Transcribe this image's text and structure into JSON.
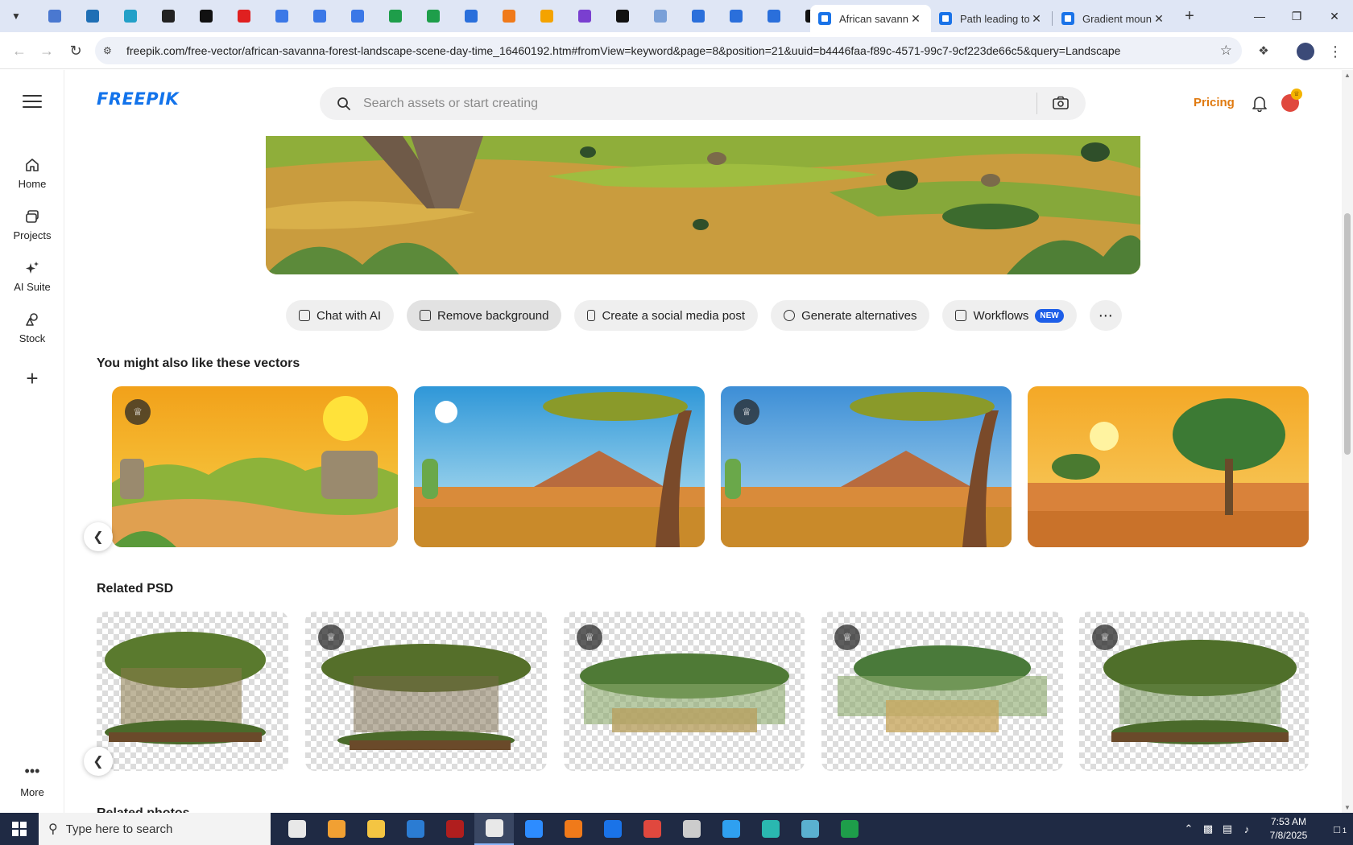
{
  "browser": {
    "tabs": [
      {
        "title": "African savanna",
        "active": true
      },
      {
        "title": "Path leading to",
        "active": false
      },
      {
        "title": "Gradient moun",
        "active": false
      }
    ],
    "url": "freepik.com/free-vector/african-savanna-forest-landscape-scene-day-time_16460192.htm#fromView=keyword&page=8&position=21&uuid=b4446faa-f89c-4571-99c7-9cf223de66c5&query=Landscape",
    "pinned_favicon_colors": [
      "#4a78d0",
      "#1f6fb5",
      "#23a0c8",
      "#222222",
      "#111111",
      "#e02020",
      "#3b78e7",
      "#3b78e7",
      "#3b78e7",
      "#1e9e4a",
      "#1e9e4a",
      "#2a6fdb",
      "#f07a1a",
      "#f4a300",
      "#7a3fd0",
      "#111111",
      "#7aa0d8",
      "#2a6fdb",
      "#2a6fdb",
      "#2a6fdb",
      "#111111"
    ]
  },
  "sidebar": {
    "items": [
      {
        "label": "Home",
        "icon": "home-icon"
      },
      {
        "label": "Projects",
        "icon": "projects-icon"
      },
      {
        "label": "AI Suite",
        "icon": "sparkle-icon"
      },
      {
        "label": "Stock",
        "icon": "stock-icon"
      }
    ],
    "more_label": "More"
  },
  "header": {
    "logo": "FREEPIK",
    "search_placeholder": "Search assets or start creating",
    "pricing_label": "Pricing"
  },
  "tools": [
    {
      "label": "Chat with AI",
      "icon": "chat-icon"
    },
    {
      "label": "Remove background",
      "icon": "remove-bg-icon"
    },
    {
      "label": "Create a social media post",
      "icon": "phone-icon"
    },
    {
      "label": "Generate alternatives",
      "icon": "refresh-icon"
    },
    {
      "label": "Workflows",
      "icon": "workflow-icon",
      "badge": "NEW"
    }
  ],
  "sections": {
    "vectors_title": "You might also like these vectors",
    "psd_title": "Related PSD",
    "photos_title": "Related photos"
  },
  "vectors": [
    {
      "scene": "sunset-savanna",
      "premium": true
    },
    {
      "scene": "acacia-desert",
      "premium": false
    },
    {
      "scene": "acacia-desert-blue",
      "premium": true
    },
    {
      "scene": "sunset-trees",
      "premium": false
    }
  ],
  "psd": [
    {
      "scene": "tree-cluster-1",
      "premium": false
    },
    {
      "scene": "tree-cluster-2",
      "premium": true
    },
    {
      "scene": "tree-cluster-3",
      "premium": true
    },
    {
      "scene": "tree-cluster-4",
      "premium": true
    },
    {
      "scene": "tree-cluster-5",
      "premium": true
    }
  ],
  "taskbar": {
    "search_placeholder": "Type here to search",
    "time": "7:53 AM",
    "date": "7/8/2025",
    "notification_count": "1",
    "app_colors": [
      "#e8e8e8",
      "#f1a033",
      "#f4c542",
      "#2b7cd3",
      "#b01e1e",
      "#e8e8e8",
      "#2d8cff",
      "#f07a1a",
      "#1a73e8",
      "#e0483e",
      "#cccccc",
      "#2fa0f0",
      "#2ab8b0",
      "#5ab0d0",
      "#1e9e4a"
    ]
  },
  "colors": {
    "brand": "#1273eb",
    "pricing": "#e07a10",
    "new_badge": "#1d5ee8"
  }
}
